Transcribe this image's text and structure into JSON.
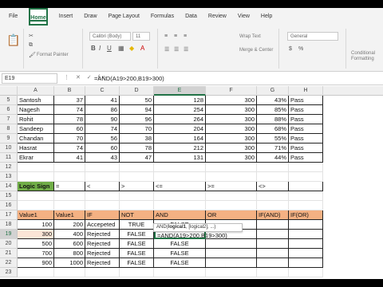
{
  "ribbon": {
    "tabs": [
      "File",
      "Home",
      "Insert",
      "Draw",
      "Page Layout",
      "Formulas",
      "Data",
      "Review",
      "View",
      "Help"
    ],
    "active_tab": "Home",
    "font_name": "Calibri (Body)",
    "font_size": "11",
    "wrap_text": "Wrap Text",
    "merge_center": "Merge & Center",
    "number_format": "General",
    "format_painter": "Format Painter",
    "conditional": "Conditional Formatting"
  },
  "formula_bar": {
    "name_box": "E19",
    "formula": "=AND(A19>200,B19>300)"
  },
  "columns": [
    "A",
    "B",
    "C",
    "D",
    "E",
    "F",
    "G",
    "H"
  ],
  "top_rows": [
    {
      "row": "5",
      "name": "Santosh",
      "v1": "37",
      "v2": "41",
      "v3": "50",
      "total": "128",
      "max": "300",
      "pct": "43%",
      "res": "Pass"
    },
    {
      "row": "6",
      "name": "Nagesh",
      "v1": "74",
      "v2": "86",
      "v3": "94",
      "total": "254",
      "max": "300",
      "pct": "85%",
      "res": "Pass"
    },
    {
      "row": "7",
      "name": "Rohit",
      "v1": "78",
      "v2": "90",
      "v3": "96",
      "total": "264",
      "max": "300",
      "pct": "88%",
      "res": "Pass"
    },
    {
      "row": "8",
      "name": "Sandeep",
      "v1": "60",
      "v2": "74",
      "v3": "70",
      "total": "204",
      "max": "300",
      "pct": "68%",
      "res": "Pass"
    },
    {
      "row": "9",
      "name": "Chandan",
      "v1": "70",
      "v2": "56",
      "v3": "38",
      "total": "164",
      "max": "300",
      "pct": "55%",
      "res": "Pass"
    },
    {
      "row": "10",
      "name": "Hasrat",
      "v1": "74",
      "v2": "60",
      "v3": "78",
      "total": "212",
      "max": "300",
      "pct": "71%",
      "res": "Pass"
    },
    {
      "row": "11",
      "name": "Ekrar",
      "v1": "41",
      "v2": "43",
      "v3": "47",
      "total": "131",
      "max": "300",
      "pct": "44%",
      "res": "Pass"
    }
  ],
  "empty_rows": [
    "12",
    "13",
    "15",
    "16"
  ],
  "logic_row": {
    "row": "14",
    "label": "Logic Sign",
    "signs": [
      "=",
      "<",
      ">",
      "<=",
      ">=",
      "<>"
    ]
  },
  "table_header": {
    "row": "17",
    "cols": [
      "Value1",
      "Value1",
      "IF",
      "NOT",
      "AND",
      "OR",
      "IF(AND)",
      "IF(OR)"
    ]
  },
  "table_rows": [
    {
      "row": "18",
      "a": "100",
      "b": "200",
      "c": "Accepeted",
      "d": "TRUE",
      "e": "FALSE"
    },
    {
      "row": "19",
      "a": "300",
      "b": "400",
      "c": "Rejected",
      "d": "FALSE",
      "e": "=AND(A19>200,B19>300)"
    },
    {
      "row": "20",
      "a": "500",
      "b": "600",
      "c": "Rejected",
      "d": "FALSE",
      "e": "FALSE"
    },
    {
      "row": "21",
      "a": "700",
      "b": "800",
      "c": "Rejected",
      "d": "FALSE",
      "e": "FALSE"
    },
    {
      "row": "22",
      "a": "900",
      "b": "1000",
      "c": "Rejected",
      "d": "FALSE",
      "e": "FALSE"
    },
    {
      "row": "23",
      "a": "",
      "b": "",
      "c": "",
      "d": "",
      "e": ""
    }
  ],
  "tooltip": {
    "fn": "AND(",
    "arg1": "logical1",
    "rest": ", [logical2], ...)"
  }
}
